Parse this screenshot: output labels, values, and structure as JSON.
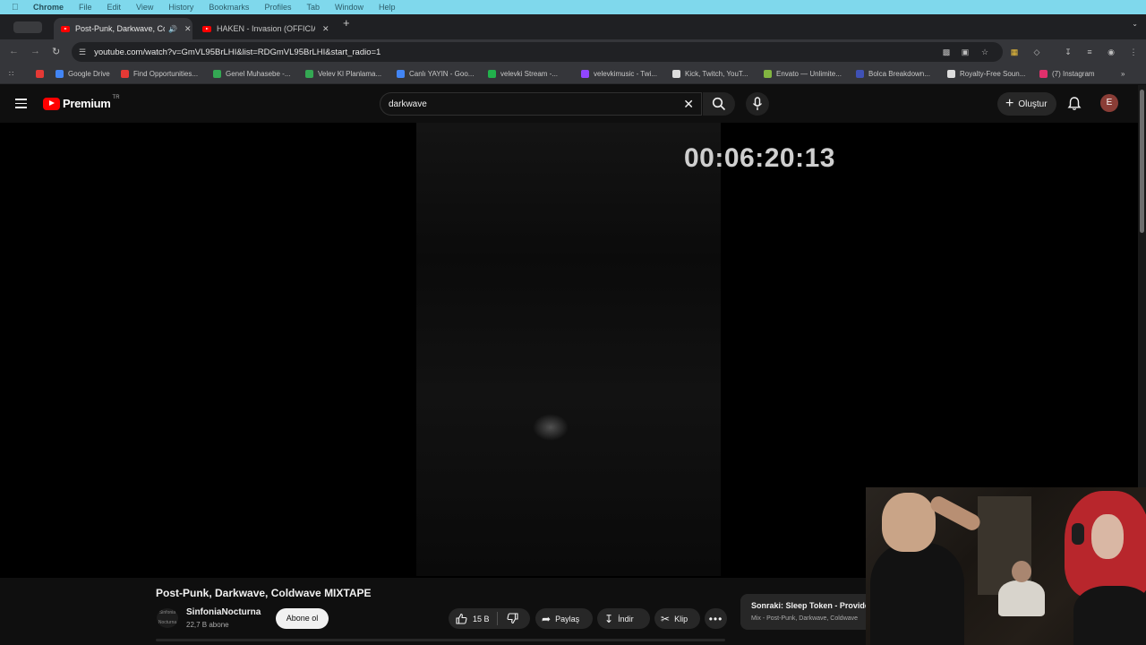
{
  "menubar": {
    "app": "Chrome",
    "items": [
      "File",
      "Edit",
      "View",
      "History",
      "Bookmarks",
      "Profiles",
      "Tab",
      "Window",
      "Help"
    ]
  },
  "tabs": {
    "active_label": "Post-Punk, Darkwave, Co",
    "inactive_label": "HAKEN - Invasion (OFFICIAL"
  },
  "toolbar": {
    "url": "youtube.com/watch?v=GmVL95BrLHI&list=RDGmVL95BrLHI&start_radio=1"
  },
  "bookmarks": [
    {
      "label": "Google Drive",
      "color": "#4285f4"
    },
    {
      "label": "Find Opportunities...",
      "color": "#e53935"
    },
    {
      "label": "Genel Muhasebe -...",
      "color": "#34a853"
    },
    {
      "label": "Velev Kl Planlama...",
      "color": "#34a853"
    },
    {
      "label": "Canlı YAYIN - Goo...",
      "color": "#4285f4"
    },
    {
      "label": "velevki Stream -...",
      "color": "#22b14c"
    },
    {
      "label": "velevkimusic - Twi...",
      "color": "#9146ff"
    },
    {
      "label": "Kick, Twitch, YouT...",
      "color": "#dddddd"
    },
    {
      "label": "Envato — Unlimite...",
      "color": "#82b541"
    },
    {
      "label": "Bolca Breakdown...",
      "color": "#3f51b5"
    },
    {
      "label": "Royalty-Free Soun...",
      "color": "#dddddd"
    },
    {
      "label": "(7) Instagram",
      "color": "#e1306c"
    }
  ],
  "youtube": {
    "logo_text": "Premium",
    "country_code": "TR",
    "search_query": "darkwave",
    "create_label": "Oluştur",
    "avatar_letter": "E"
  },
  "video": {
    "timecode": "00:06:20:13",
    "title": "Post-Punk, Darkwave, Coldwave MIXTAPE",
    "channel_name": "SinfoniaNocturna",
    "channel_avatar_text": "Sinfonia Nocturna",
    "subscribers": "22,7 B abone",
    "subscribe_label": "Abone ol",
    "likes": "15 B",
    "share_label": "Paylaş",
    "download_label": "İndir",
    "clip_label": "Klip",
    "more_label": "•••"
  },
  "next_up": {
    "title": "Sonraki: Sleep Token - Provider",
    "subtitle": "Mix - Post-Punk, Darkwave, Coldwave"
  }
}
